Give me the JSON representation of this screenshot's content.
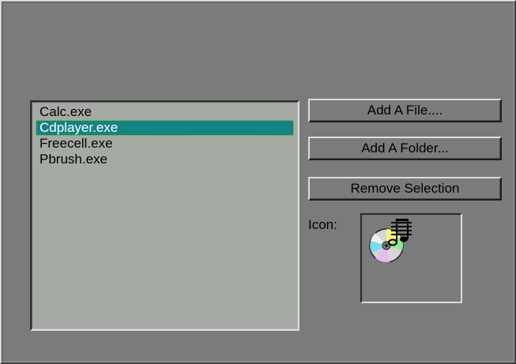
{
  "file_list": {
    "items": [
      "Calc.exe",
      "Cdplayer.exe",
      "Freecell.exe",
      "Pbrush.exe"
    ],
    "selected_index": 1
  },
  "buttons": {
    "add_file": "Add A File....",
    "add_folder": "Add A Folder...",
    "remove_selection": "Remove Selection"
  },
  "icon_preview": {
    "label": "Icon:",
    "icon_name": "cd-player-icon"
  },
  "colors": {
    "panel": "#7b7b7b",
    "list_background": "#a6aaa5",
    "selection": "#158285"
  }
}
